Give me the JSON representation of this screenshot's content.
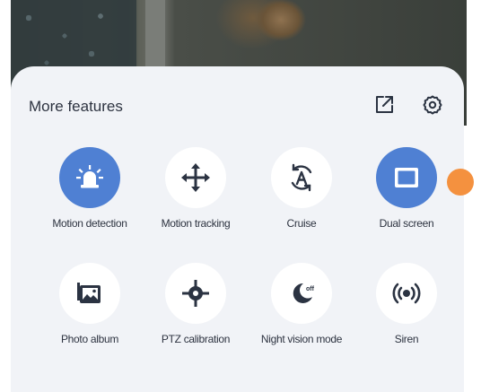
{
  "panel": {
    "title": "More features",
    "header_icons": [
      "external-link-icon",
      "gear-icon"
    ]
  },
  "features": [
    {
      "label": "Motion detection",
      "icon": "siren-light-icon",
      "active": true
    },
    {
      "label": "Motion tracking",
      "icon": "move-arrows-icon",
      "active": false
    },
    {
      "label": "Cruise",
      "icon": "auto-rotate-icon",
      "active": false
    },
    {
      "label": "Dual screen",
      "icon": "dual-screen-icon",
      "active": true
    },
    {
      "label": "Photo album",
      "icon": "photo-album-icon",
      "active": false
    },
    {
      "label": "PTZ calibration",
      "icon": "crosshair-icon",
      "active": false
    },
    {
      "label": "Night vision mode",
      "icon": "moon-off-icon",
      "active": false
    },
    {
      "label": "Siren",
      "icon": "siren-waves-icon",
      "active": false
    }
  ],
  "colors": {
    "accent": "#4f80d3",
    "panel_bg": "#f1f3f7",
    "text": "#2d3340",
    "icon_dark": "#2b3342",
    "float_dot": "#f4913f"
  }
}
